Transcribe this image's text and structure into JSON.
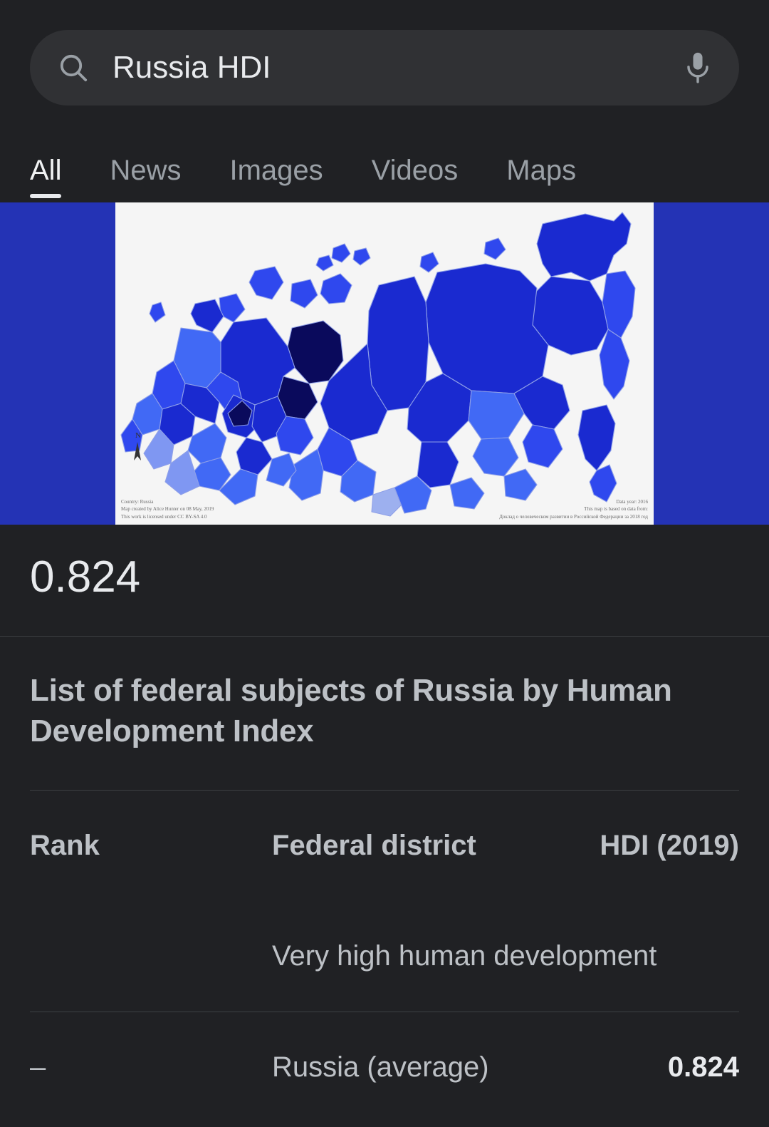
{
  "search": {
    "query": "Russia HDI",
    "search_icon": "search-icon",
    "mic_icon": "microphone-icon"
  },
  "tabs": [
    {
      "label": "All",
      "active": true
    },
    {
      "label": "News",
      "active": false
    },
    {
      "label": "Images",
      "active": false
    },
    {
      "label": "Videos",
      "active": false
    },
    {
      "label": "Maps",
      "active": false
    }
  ],
  "hero": {
    "image_alt": "choropleth-map-of-russia-by-hdi",
    "letterbox_color": "#2433b5",
    "panel_color": "#f5f5f5",
    "caption_left": "Country: Russia\nMap created by Alice Hunter on 08 May, 2019\nThis work is licensed under CC BY-SA 4.0",
    "caption_right": "Data year: 2016\nThis map is based on data from:\nДоклад о человеческом развитии в Российской Федерации за 2018 год",
    "compass_label": "N",
    "legend_colors": [
      "#0a0a5c",
      "#101fa8",
      "#1a2ad0",
      "#2f48ee",
      "#4169f5",
      "#7f97f2",
      "#9db0ef"
    ]
  },
  "answer": {
    "value": "0.824"
  },
  "result": {
    "title": "List of federal subjects of Russia by Human Development Index"
  },
  "table": {
    "headers": {
      "rank": "Rank",
      "district": "Federal district",
      "hdi": "HDI (2019)"
    },
    "category_row": "Very high human development",
    "rows": [
      {
        "rank": "–",
        "district": "Russia (average)",
        "hdi": "0.824"
      }
    ]
  }
}
